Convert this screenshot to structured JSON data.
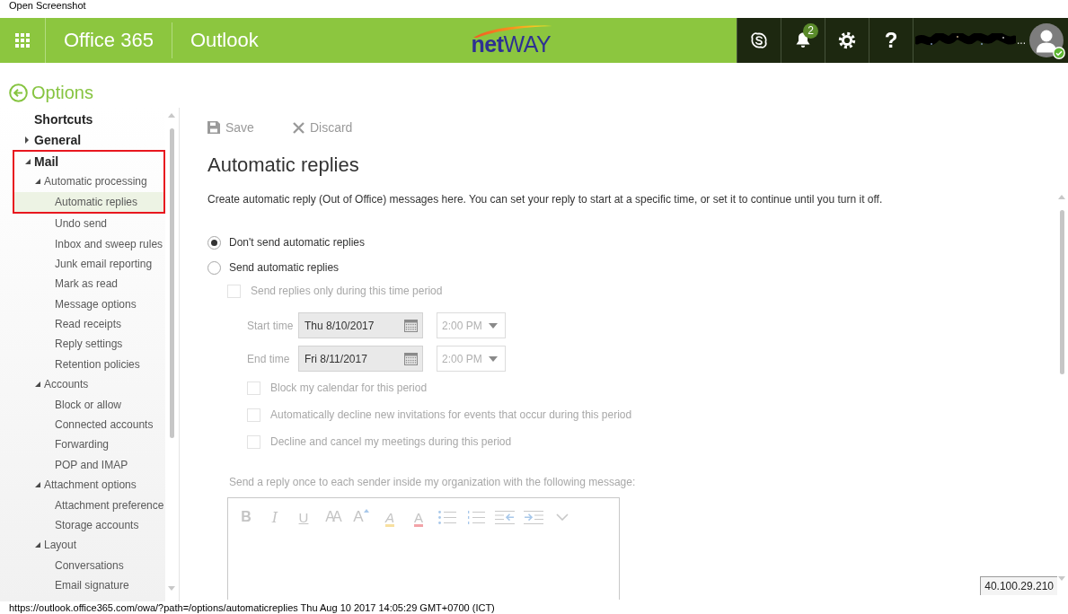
{
  "page_title": "Open Screenshot",
  "header": {
    "suite_name": "Office 365",
    "app_name": "Outlook",
    "logo": "**net**WAY",
    "notification_count": "2",
    "help_glyph": "?",
    "user_name": "..."
  },
  "back_link": "Options",
  "sidebar": {
    "items": [
      {
        "label": "Shortcuts",
        "selected": false,
        "annotated": false
      },
      {
        "label": "General",
        "selected": false,
        "annotated": false,
        "expanded": false
      },
      {
        "label": "Mail",
        "selected": false,
        "annotated": true,
        "expanded": true,
        "children": [
          {
            "label": "Automatic processing",
            "selected": false,
            "annotated": true,
            "expanded": true,
            "children": [
              {
                "label": "Automatic replies",
                "selected": true,
                "annotated": true
              },
              {
                "label": "Undo send",
                "selected": false,
                "annotated": false
              },
              {
                "label": "Inbox and sweep rules",
                "selected": false,
                "annotated": false
              },
              {
                "label": "Junk email reporting",
                "selected": false,
                "annotated": false
              },
              {
                "label": "Mark as read",
                "selected": false,
                "annotated": false
              },
              {
                "label": "Message options",
                "selected": false,
                "annotated": false
              },
              {
                "label": "Read receipts",
                "selected": false,
                "annotated": false
              },
              {
                "label": "Reply settings",
                "selected": false,
                "annotated": false
              },
              {
                "label": "Retention policies",
                "selected": false,
                "annotated": false
              }
            ]
          },
          {
            "label": "Accounts",
            "selected": false,
            "annotated": false,
            "expanded": true,
            "children": [
              {
                "label": "Block or allow",
                "selected": false,
                "annotated": false
              },
              {
                "label": "Connected accounts",
                "selected": false,
                "annotated": false
              },
              {
                "label": "Forwarding",
                "selected": false,
                "annotated": false
              },
              {
                "label": "POP and IMAP",
                "selected": false,
                "annotated": false
              }
            ]
          },
          {
            "label": "Attachment options",
            "selected": false,
            "annotated": false,
            "expanded": true,
            "children": [
              {
                "label": "Attachment preference",
                "selected": false,
                "annotated": false
              },
              {
                "label": "Storage accounts",
                "selected": false,
                "annotated": false
              }
            ]
          },
          {
            "label": "Layout",
            "selected": false,
            "annotated": false,
            "expanded": true,
            "children": [
              {
                "label": "Conversations",
                "selected": false,
                "annotated": false
              },
              {
                "label": "Email signature",
                "selected": false,
                "annotated": false
              }
            ]
          }
        ]
      }
    ]
  },
  "toolbar": [
    {
      "kind": "save",
      "label": "Save",
      "disabled": true
    },
    {
      "kind": "discard",
      "label": "Discard",
      "disabled": true
    }
  ],
  "page": {
    "title": "Automatic replies",
    "description": "Create automatic reply (Out of Office) messages here. You can set your reply to start at a specific time, or set it to continue until you turn it off.",
    "reply_mode": [
      {
        "label": "Don't send automatic replies",
        "selected": true
      },
      {
        "label": "Send automatic replies",
        "selected": false
      }
    ],
    "time_period": {
      "label": "Send replies only during this time period",
      "checked": false,
      "disabled": true
    },
    "times": [
      {
        "label": "Start time",
        "date": "Thu 8/10/2017",
        "time": "2:00 PM",
        "disabled": true
      },
      {
        "label": "End time",
        "date": "Fri 8/11/2017",
        "time": "2:00 PM",
        "disabled": true
      }
    ],
    "options": [
      {
        "label": "Block my calendar for this period",
        "checked": false,
        "disabled": true
      },
      {
        "label": "Automatically decline new invitations for events that occur during this period",
        "checked": false,
        "disabled": true
      },
      {
        "label": "Decline and cancel my meetings during this period",
        "checked": false,
        "disabled": true
      }
    ],
    "message_label": "Send a reply once to each sender inside my organization with the following message:",
    "editor": {
      "disabled": true,
      "tools": [
        {
          "kind": "bold",
          "glyph": "B"
        },
        {
          "kind": "italic",
          "glyph": "I"
        },
        {
          "kind": "underline",
          "glyph": "U"
        },
        {
          "kind": "font-size",
          "glyph": "AA"
        },
        {
          "kind": "grow-font",
          "glyph": "A"
        },
        {
          "kind": "highlight",
          "glyph": "A"
        },
        {
          "kind": "font-color",
          "glyph": "A"
        },
        {
          "kind": "bullets"
        },
        {
          "kind": "numbering"
        },
        {
          "kind": "outdent"
        },
        {
          "kind": "indent"
        },
        {
          "kind": "more"
        }
      ]
    }
  },
  "ip_badge": "40.100.29.210",
  "status_bar": "https://outlook.office365.com/owa/?path=/options/automaticreplies Thu Aug 10 2017 14:05:29 GMT+0700 (ICT)"
}
